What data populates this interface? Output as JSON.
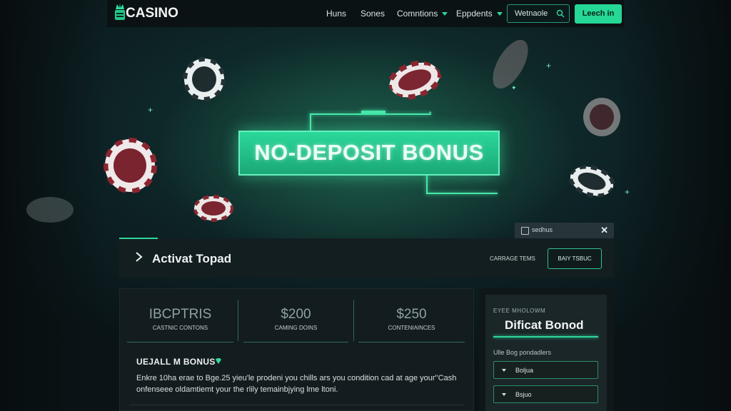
{
  "nav": {
    "logo": "CASINO",
    "links": [
      {
        "label": "Huns",
        "dropdown": false
      },
      {
        "label": "Sones",
        "dropdown": false
      },
      {
        "label": "Comntions",
        "dropdown": true
      },
      {
        "label": "Eppdents",
        "dropdown": true
      }
    ],
    "search_value": "Wetnaole",
    "login_label": "Leech in"
  },
  "hero": {
    "banner": "NO-DEPOSIT BONUS"
  },
  "notification": {
    "text": "sedhus"
  },
  "activate": {
    "title": "Activat Topad",
    "link": "CARRAGE TEMS",
    "button": "BAIY TSBUC"
  },
  "stats": [
    {
      "value": "IBCPTRIS",
      "label": "CASTNIC CONTONS"
    },
    {
      "value": "$200",
      "label": "CAMING DOINS"
    },
    {
      "value": "$250",
      "label": "CONTENIAINCES"
    }
  ],
  "bonus": {
    "title": "UEJALL M BONUS",
    "body": "Enkre 10ha erae to Bge.25 yieu'le prodeni you chills ars you condition cad at age your''Cash onfenseee oldamtiemt your the rlily temainbjying lme ltoni."
  },
  "side_panel": {
    "eyebrow": "EYEE MHOLOWM",
    "title": "Dificat Bonod",
    "subtitle": "Ulle Bog pondadlers",
    "options": [
      "Boljua",
      "Bsjuo"
    ]
  },
  "colors": {
    "accent": "#2fd79a",
    "background": "#0b1316",
    "panel": "#131c1f"
  }
}
